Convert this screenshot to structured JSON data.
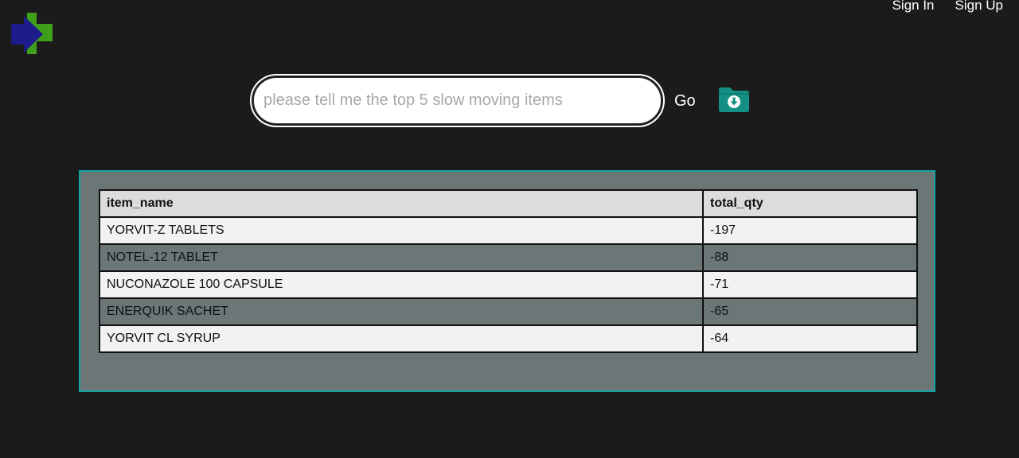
{
  "nav": {
    "sign_in": "Sign In",
    "sign_up": "Sign Up"
  },
  "search": {
    "value": "",
    "placeholder": "please tell me the top 5 slow moving items"
  },
  "go_label": "Go",
  "icons": {
    "logo": "cross-logo-icon",
    "download": "folder-download-icon"
  },
  "colors": {
    "background": "#1b1b1b",
    "panel": "#6b7677",
    "panel_border": "#13a3a3",
    "download_icon": "#138f83",
    "logo_blue": "#1c1c8c",
    "logo_green": "#3f9f1a"
  },
  "table": {
    "headers": [
      "item_name",
      "total_qty"
    ],
    "rows": [
      [
        "YORVIT-Z TABLETS",
        "-197"
      ],
      [
        "NOTEL-12 TABLET",
        "-88"
      ],
      [
        "NUCONAZOLE 100 CAPSULE",
        "-71"
      ],
      [
        "ENERQUIK SACHET",
        "-65"
      ],
      [
        "YORVIT CL SYRUP",
        "-64"
      ]
    ]
  }
}
